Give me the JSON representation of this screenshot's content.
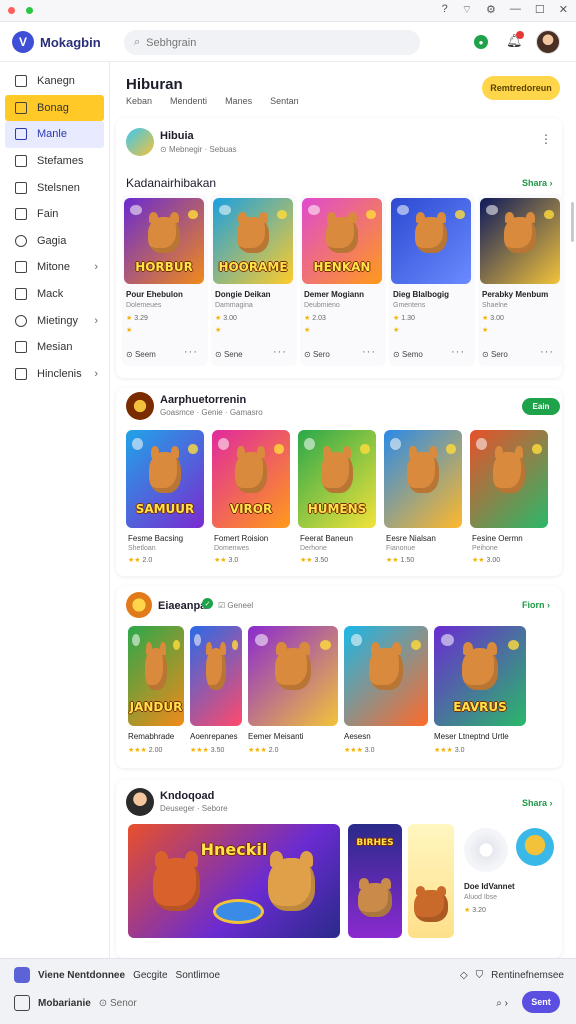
{
  "app": {
    "title": "Mokagbin",
    "search_placeholder": "Sebhgrain"
  },
  "sidebar": {
    "items": [
      {
        "label": "Kanegn",
        "icon": "home-icon"
      },
      {
        "label": "Bonag",
        "icon": "gamepad-icon"
      },
      {
        "label": "Manle",
        "icon": "tablet-icon"
      },
      {
        "label": "Stefames",
        "icon": "store-icon"
      },
      {
        "label": "Stelsnen",
        "icon": "image-icon"
      },
      {
        "label": "Fain",
        "icon": "list-icon"
      },
      {
        "label": "Gagia",
        "icon": "globe-icon"
      },
      {
        "label": "Mitone",
        "icon": "menu-icon"
      },
      {
        "label": "Mack",
        "icon": "edit-icon"
      },
      {
        "label": "Mietingy",
        "icon": "settings-icon"
      },
      {
        "label": "Mesian",
        "icon": "calendar-icon"
      },
      {
        "label": "Hinclenis",
        "icon": "folder-icon"
      }
    ]
  },
  "page": {
    "title": "Hiburan",
    "tabs": [
      "Keban",
      "Mendenti",
      "Manes",
      "Sentan"
    ],
    "cta_label": "Remtredoreun"
  },
  "section1": {
    "author": "Hibuia",
    "author_meta": "Mebnegir",
    "author_meta2": "Sebuas",
    "heading": "Kadanairhibakan",
    "see_all": "Shara",
    "games": [
      {
        "tile": "HORBUR",
        "title": "Pour Ehebulon",
        "sub": "Dolemeues",
        "rating": "3.29",
        "foot": "Seem",
        "colors": [
          "#6a2bd1",
          "#f08a1a"
        ]
      },
      {
        "title": "Dongie Deikan",
        "tile": "HOORAME",
        "sub": "Dammagina",
        "rating": "3.00",
        "foot": "Sene",
        "colors": [
          "#1aa0e0",
          "#ffcc2a"
        ]
      },
      {
        "title": "Demer Mogiann",
        "tile": "HENKAN",
        "sub": "Deubmieno",
        "rating": "2.03",
        "foot": "Sero",
        "colors": [
          "#e04ad0",
          "#ff9a1a"
        ]
      },
      {
        "title": "Dieg Blalbogig",
        "tile": "",
        "sub": "Gmentens",
        "rating": "1.30",
        "foot": "Semo",
        "colors": [
          "#2b4ad1",
          "#6a8bff"
        ]
      },
      {
        "title": "Perabky Menbum",
        "tile": "",
        "sub": "Shaelne",
        "rating": "3.00",
        "foot": "Sero",
        "colors": [
          "#0d1a5c",
          "#f2c33a"
        ]
      }
    ]
  },
  "section2": {
    "author": "Aarphuetorrenin",
    "meta": [
      "Goasmce",
      "Genie",
      "Gamasro"
    ],
    "follow_label": "Eain",
    "games": [
      {
        "tile": "SAMUUR",
        "title": "Fesme Bacsing",
        "sub": "Shetloan",
        "rating": "2.0",
        "colors": [
          "#20a4e8",
          "#7a2bd0"
        ]
      },
      {
        "tile": "VIROR",
        "title": "Fomert Roision",
        "sub": "Domenwes",
        "rating": "3.0",
        "colors": [
          "#e02a9e",
          "#ff9a1a"
        ]
      },
      {
        "tile": "HUMENS",
        "title": "Feerat Baneun",
        "sub": "Derhone",
        "rating": "3.50",
        "colors": [
          "#2aa84a",
          "#f2e33a"
        ]
      },
      {
        "tile": "",
        "title": "Eesre Nialsan",
        "sub": "Fianonue",
        "rating": "1.50",
        "colors": [
          "#2a8ae8",
          "#ffb82a"
        ]
      },
      {
        "tile": "",
        "title": "Fesine Oermn",
        "sub": "Peihone",
        "rating": "3.00",
        "colors": [
          "#e8502a",
          "#2ab86a"
        ]
      }
    ]
  },
  "section3": {
    "author": "Eiaeanpa",
    "meta": "Geneel",
    "see_all": "Fiorn",
    "games": [
      {
        "tile": "JANDUR",
        "title": "Remabhrade",
        "rating": "2.00",
        "colors": [
          "#2aa84a",
          "#f28a1a"
        ]
      },
      {
        "tile": "",
        "title": "Aoenrepanes",
        "rating": "3.50",
        "colors": [
          "#2a6ae8",
          "#ff4a6a"
        ]
      },
      {
        "tile": "",
        "title": "Eemer Meisanti",
        "rating": "2.0",
        "colors": [
          "#8a2ad0",
          "#f2c33a"
        ]
      },
      {
        "tile": "",
        "title": "Aesesn",
        "rating": "3.0",
        "colors": [
          "#1ab8e8",
          "#ff6a2a"
        ]
      },
      {
        "tile": "EAVRUS",
        "title": "Meser Ltneptnd Urtle",
        "rating": "3.0",
        "colors": [
          "#6a2bd1",
          "#2ab86a"
        ]
      }
    ]
  },
  "section4": {
    "author": "Kndoqoad",
    "meta": [
      "Deuseger",
      "Sebore"
    ],
    "see_all": "Shara",
    "feature_tile": "Hneckil",
    "side_tile": "BIRHES",
    "side_title": "Doe IdVannet",
    "side_sub": "Aluod Ibse",
    "side_rating": "3.20"
  },
  "bottom": {
    "row1": [
      "Viene Nentdonnee",
      "Gecgite",
      "Sontlimoe"
    ],
    "row1_right": "Rentinefnemsee",
    "row2_left": "Mobarianie",
    "row2_sub": "Senor",
    "send_label": "Sent"
  }
}
